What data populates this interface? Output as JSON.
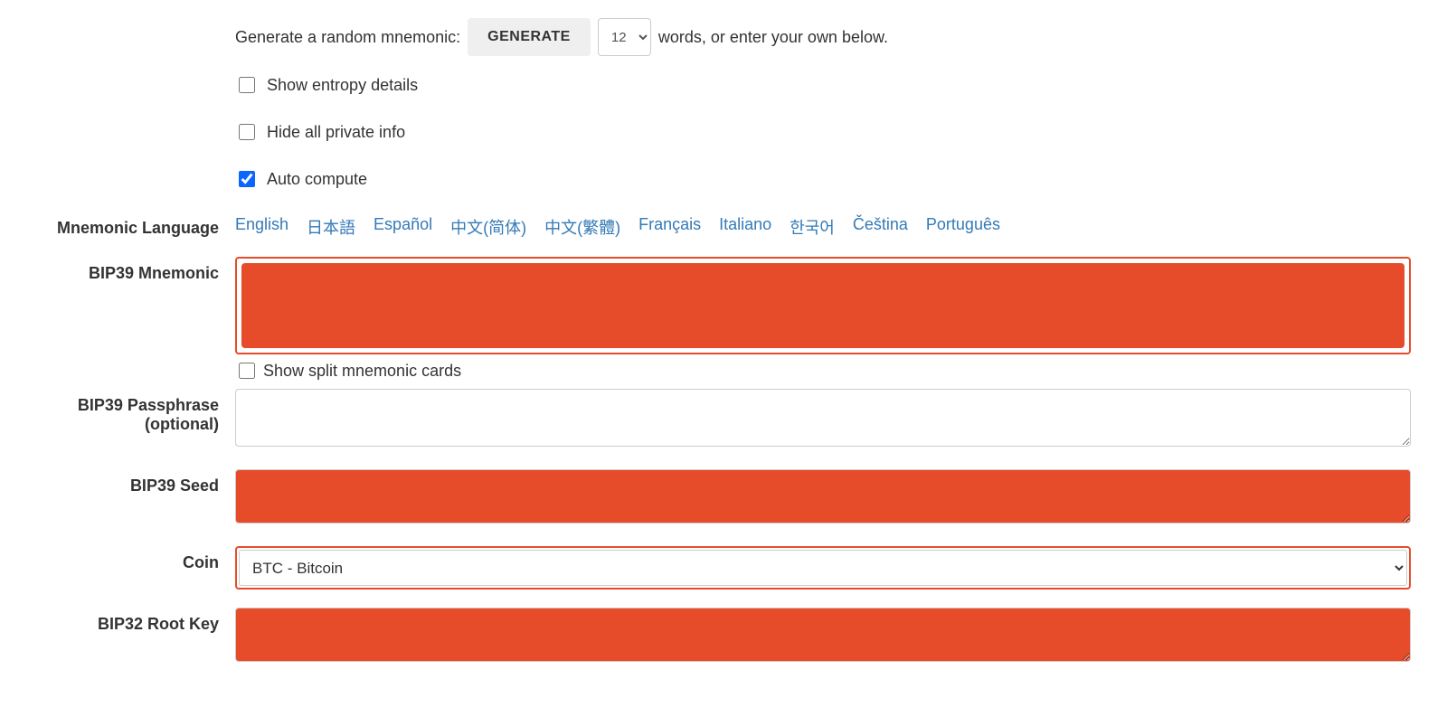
{
  "generate": {
    "prefix": "Generate a random mnemonic:",
    "button": "GENERATE",
    "word_count": "12",
    "suffix": "words, or enter your own below."
  },
  "checkboxes": {
    "show_entropy": {
      "label": "Show entropy details",
      "checked": false
    },
    "hide_private": {
      "label": "Hide all private info",
      "checked": false
    },
    "auto_compute": {
      "label": "Auto compute",
      "checked": true
    }
  },
  "labels": {
    "mnemonic_language": "Mnemonic Language",
    "bip39_mnemonic": "BIP39 Mnemonic",
    "show_split": "Show split mnemonic cards",
    "passphrase": "BIP39 Passphrase (optional)",
    "seed": "BIP39 Seed",
    "coin": "Coin",
    "root_key": "BIP32 Root Key"
  },
  "languages": [
    "English",
    "日本語",
    "Español",
    "中文(简体)",
    "中文(繁體)",
    "Français",
    "Italiano",
    "한국어",
    "Čeština",
    "Português"
  ],
  "fields": {
    "mnemonic": "",
    "passphrase": "",
    "seed": "",
    "root_key": ""
  },
  "coin": {
    "selected": "BTC - Bitcoin"
  }
}
